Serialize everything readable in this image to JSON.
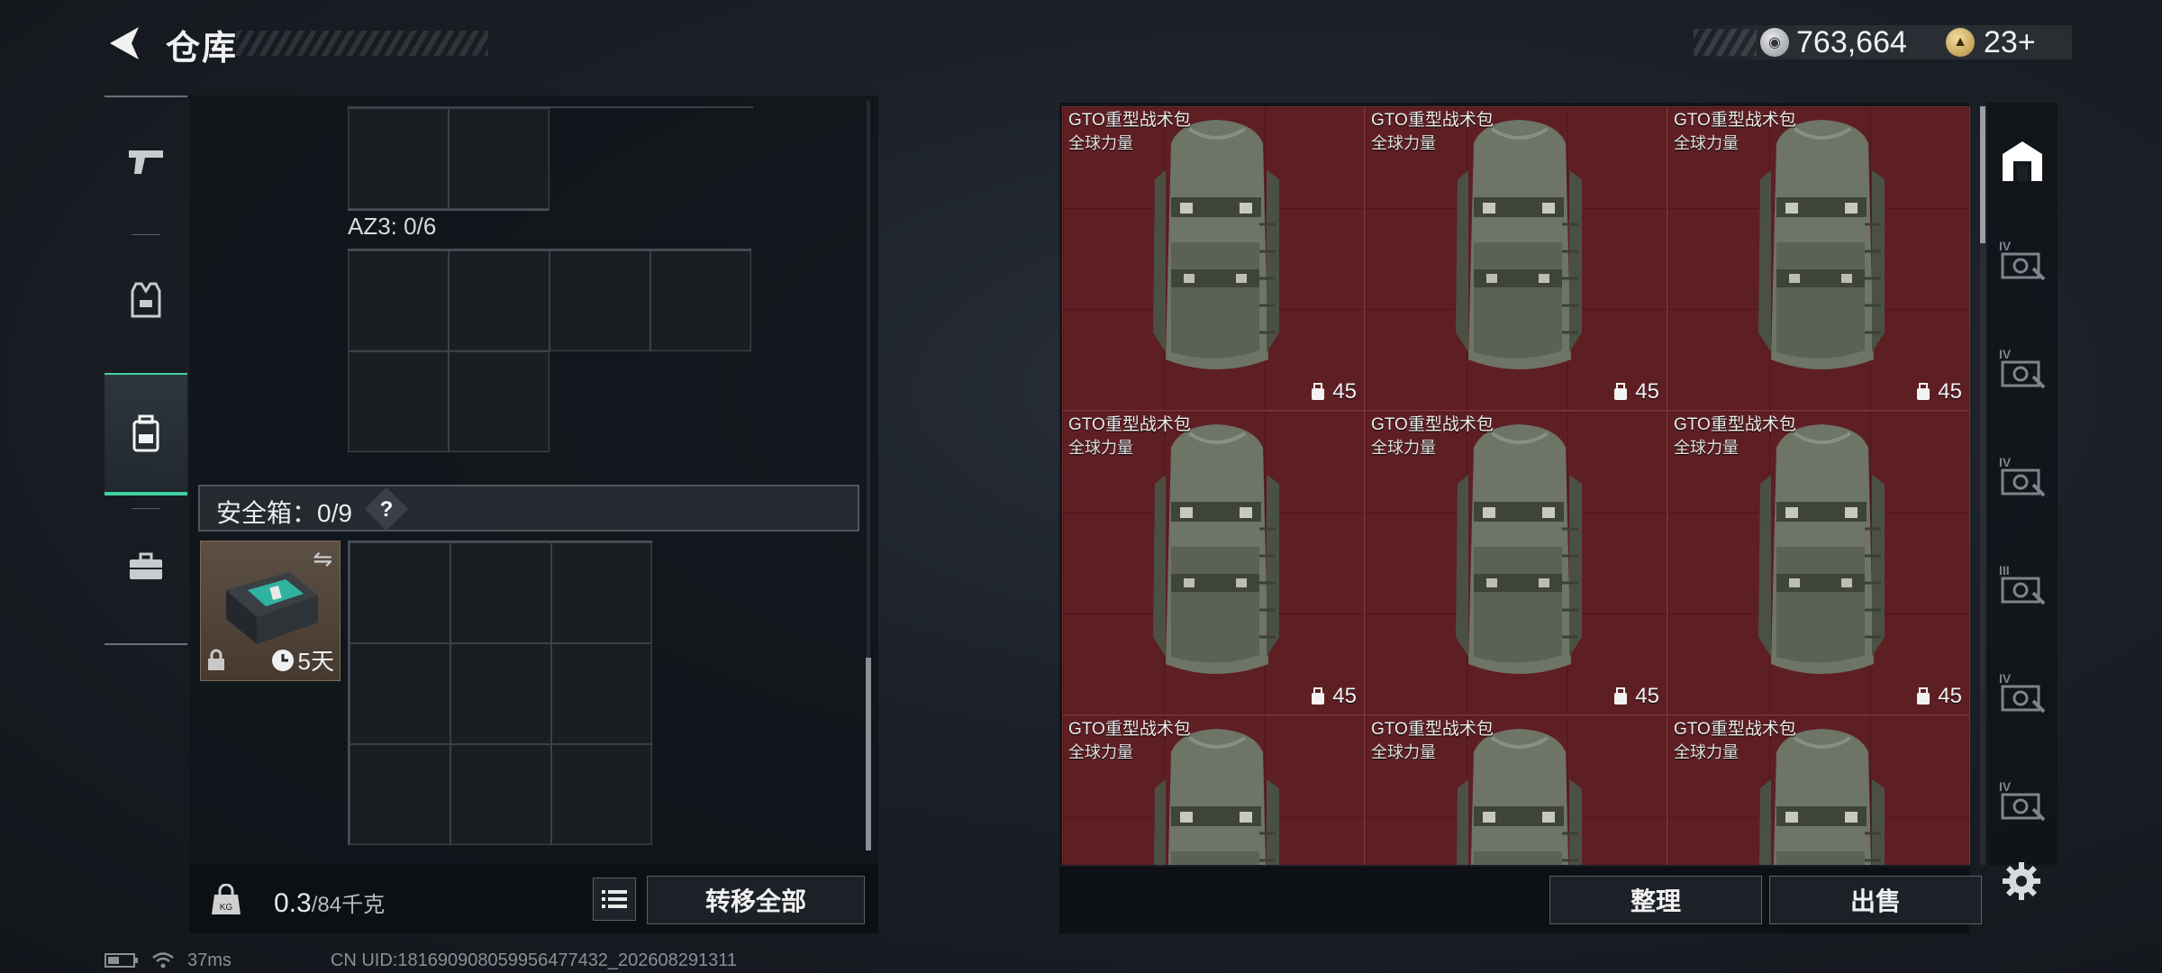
{
  "header": {
    "title": "仓库",
    "currency_value": "763,664",
    "premium_value": "23",
    "premium_plus": "+"
  },
  "left_nav": {
    "items": [
      {
        "name": "weapons",
        "icon": "pistol-icon"
      },
      {
        "name": "armor",
        "icon": "armor-vest-icon"
      },
      {
        "name": "backpack",
        "icon": "backpack-icon",
        "active": true
      },
      {
        "name": "case",
        "icon": "briefcase-icon"
      }
    ]
  },
  "storage": {
    "az3_label": "AZ3: 0/6",
    "safe_box_label": "安全箱：0/9",
    "safe_box_help": "?",
    "safe_case_timer": "5天",
    "weight_value": "0.3",
    "weight_max": "/84千克",
    "transfer_all_label": "转移全部"
  },
  "stash": {
    "items": [
      {
        "name": "GTO重型战术包",
        "sub": "全球力量",
        "capacity": "45"
      },
      {
        "name": "GTO重型战术包",
        "sub": "全球力量",
        "capacity": "45"
      },
      {
        "name": "GTO重型战术包",
        "sub": "全球力量",
        "capacity": "45"
      },
      {
        "name": "GTO重型战术包",
        "sub": "全球力量",
        "capacity": "45"
      },
      {
        "name": "GTO重型战术包",
        "sub": "全球力量",
        "capacity": "45"
      },
      {
        "name": "GTO重型战术包",
        "sub": "全球力量",
        "capacity": "45"
      },
      {
        "name": "GTO重型战术包",
        "sub": "全球力量",
        "capacity": ""
      },
      {
        "name": "GTO重型战术包",
        "sub": "全球力量",
        "capacity": ""
      },
      {
        "name": "GTO重型战术包",
        "sub": "全球力量",
        "capacity": ""
      }
    ],
    "sort_label": "整理",
    "sell_label": "出售"
  },
  "right_tabs": {
    "items": [
      {
        "name": "all",
        "icon": "warehouse-icon",
        "tier": ""
      },
      {
        "name": "tier-iv-a",
        "icon": "gear-box-icon",
        "tier": "IV"
      },
      {
        "name": "tier-iv-b",
        "icon": "gear-box-icon",
        "tier": "IV"
      },
      {
        "name": "tier-iv-c",
        "icon": "gear-box-icon",
        "tier": "IV"
      },
      {
        "name": "tier-iii",
        "icon": "gear-box-icon",
        "tier": "III"
      },
      {
        "name": "tier-iv-d",
        "icon": "medkit-box-icon",
        "tier": "IV"
      },
      {
        "name": "tier-iv-e",
        "icon": "gear-box-icon",
        "tier": "IV"
      }
    ]
  },
  "status": {
    "ping": "37ms",
    "uid": "CN UID:18169090805995647743​2_202608291311"
  },
  "colors": {
    "accent": "#3fd1a1",
    "item_bg": "#5e1f23"
  }
}
